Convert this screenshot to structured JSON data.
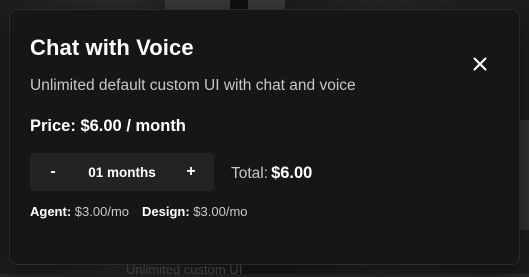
{
  "modal": {
    "title": "Chat with Voice",
    "subtitle": "Unlimited default custom UI with chat and voice",
    "price": "Price: $6.00 / month",
    "close_icon": "close-icon"
  },
  "stepper": {
    "decrement_label": "-",
    "value": "01 months",
    "increment_label": "+"
  },
  "total": {
    "label": "Total:",
    "value": "$6.00"
  },
  "breakdown": {
    "agent_label": "Agent:",
    "agent_value": "$3.00/mo",
    "design_label": "Design:",
    "design_value": "$3.00/mo"
  },
  "background": {
    "ghost_text": "Unlimited custom UI"
  },
  "colors": {
    "modal_bg": "#161616",
    "stepper_bg": "#232323",
    "primary_text": "#ffffff",
    "secondary_text": "#c8c8c8"
  }
}
